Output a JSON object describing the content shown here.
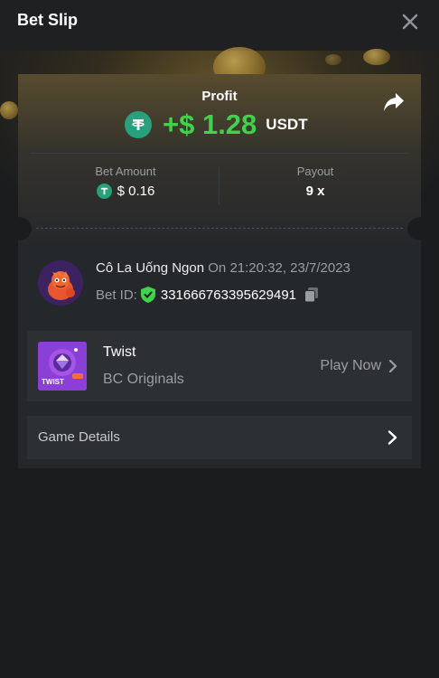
{
  "header": {
    "title": "Bet Slip"
  },
  "profit": {
    "label": "Profit",
    "amount": "+$ 1.28",
    "currency": "USDT"
  },
  "stats": {
    "bet_amount_label": "Bet Amount",
    "bet_amount_value": "$ 0.16",
    "payout_label": "Payout",
    "payout_value": "9 x"
  },
  "user": {
    "name": "Cô La Uống Ngon",
    "time": "On 21:20:32, 23/7/2023",
    "bet_id_label": "Bet ID:",
    "bet_id": "331666763395629491"
  },
  "game": {
    "name": "Twist",
    "provider": "BC Originals",
    "play_label": "Play Now",
    "thumb_text": "TWIST"
  },
  "details": {
    "label": "Game Details"
  },
  "colors": {
    "profit_green": "#3dd34a",
    "tether": "#26a17b",
    "shield": "#3dd34a"
  }
}
